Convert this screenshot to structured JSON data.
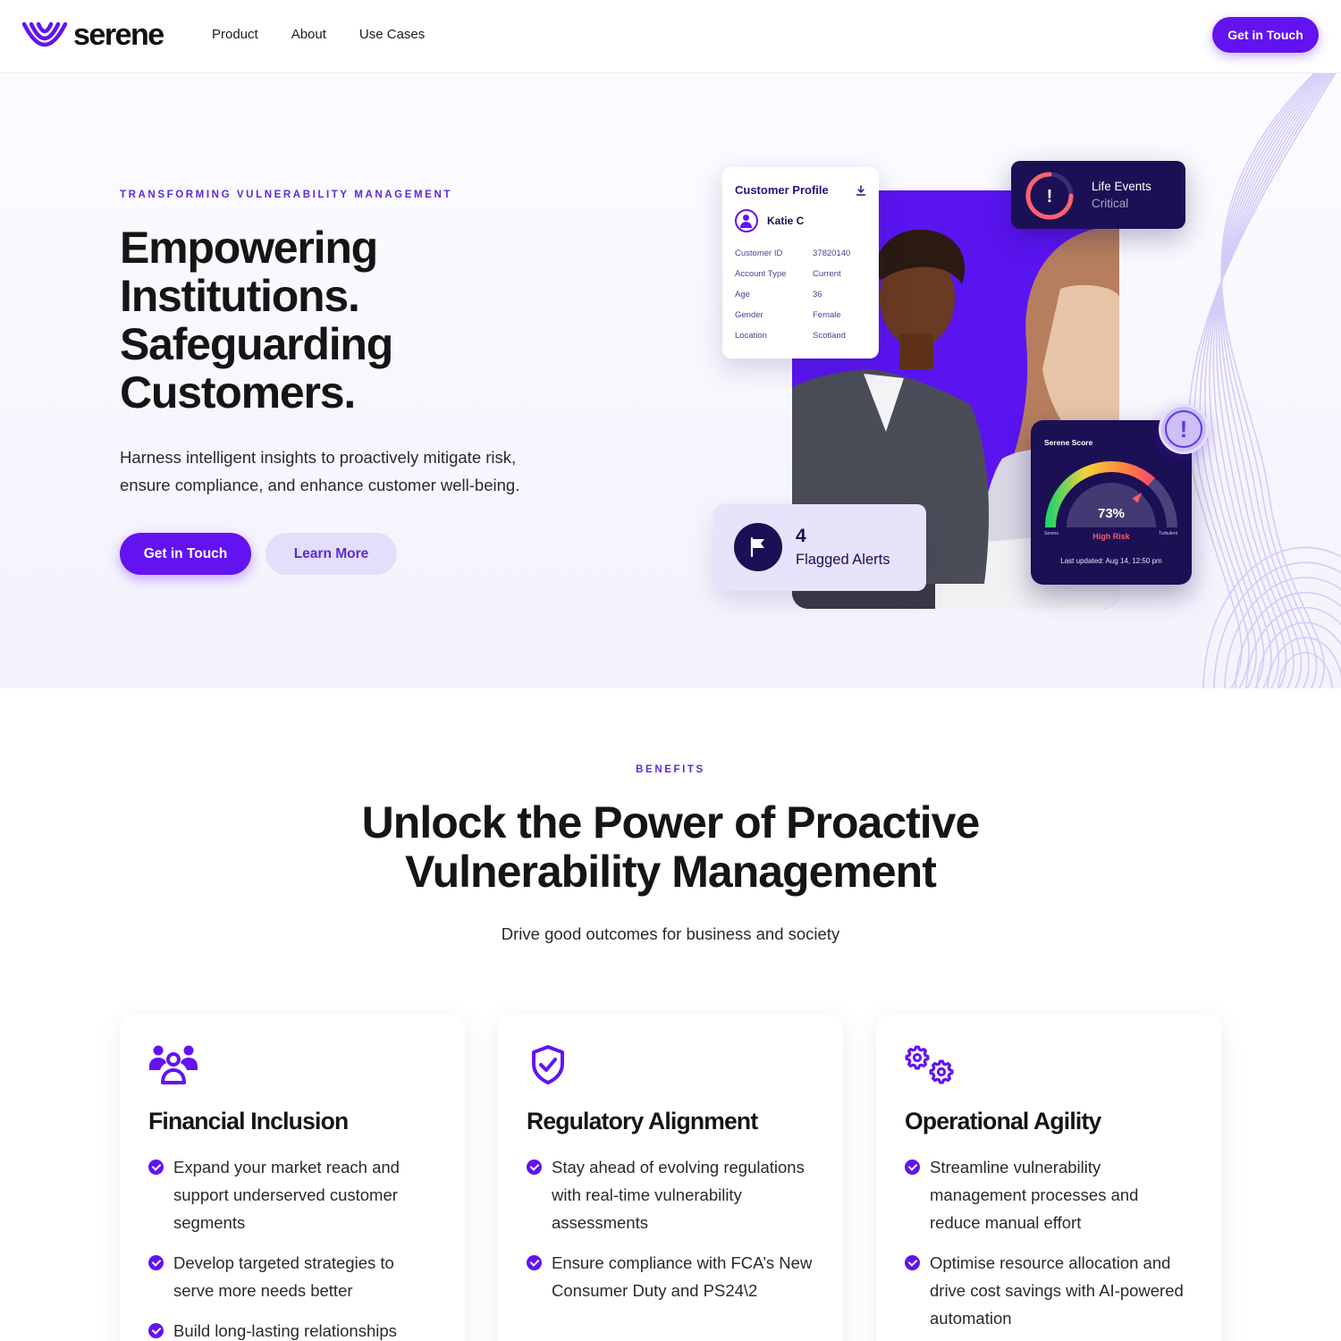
{
  "nav": {
    "brand": "serene",
    "links": [
      "Product",
      "About",
      "Use Cases"
    ],
    "cta": "Get in Touch"
  },
  "hero": {
    "eyebrow": "TRANSFORMING VULNERABILITY MANAGEMENT",
    "title_lines": [
      "Empowering",
      "Institutions.",
      "Safeguarding",
      "Customers."
    ],
    "subtitle_lines": [
      "Harness intelligent insights to proactively mitigate risk,",
      "ensure compliance, and enhance customer well-being."
    ],
    "primary_button": "Get in Touch",
    "secondary_button": "Learn More"
  },
  "profile_card": {
    "title": "Customer Profile",
    "name": "Katie C",
    "rows": [
      {
        "key": "Customer ID",
        "value": "37820140"
      },
      {
        "key": "Account Type",
        "value": "Current"
      },
      {
        "key": "Age",
        "value": "36"
      },
      {
        "key": "Gender",
        "value": "Female"
      },
      {
        "key": "Location",
        "value": "Scotland"
      }
    ]
  },
  "life_events": {
    "title": "Life Events",
    "status": "Critical",
    "icon_symbol": "!"
  },
  "flagged": {
    "count": "4",
    "label": "Flagged Alerts"
  },
  "score": {
    "title": "Serene Score",
    "percent_text": "73%",
    "percent": 73,
    "risk": "High Risk",
    "left_label": "Serene",
    "right_label": "Turbulent",
    "updated": "Last updated: Aug 14, 12:50 pm"
  },
  "alert_badge": "!",
  "benefits": {
    "eyebrow": "BENEFITS",
    "title_lines": [
      "Unlock the Power of Proactive",
      "Vulnerability Management"
    ],
    "subtitle": "Drive good outcomes for business and society",
    "cards": [
      {
        "icon": "users-icon",
        "title": "Financial Inclusion",
        "items": [
          "Expand your market reach and support underserved customer segments",
          "Develop targeted strategies to serve more needs better",
          "Build long-lasting relationships"
        ]
      },
      {
        "icon": "shield-check-icon",
        "title": "Regulatory Alignment",
        "items": [
          "Stay ahead of evolving regulations with real-time vulnerability assessments",
          "Ensure compliance with FCA’s New Consumer Duty and PS24\\2"
        ]
      },
      {
        "icon": "gears-icon",
        "title": "Operational Agility",
        "items": [
          "Streamline vulnerability management processes and reduce manual effort",
          "Optimise resource allocation and drive cost savings with AI-powered automation"
        ]
      }
    ]
  },
  "colors": {
    "accent": "#6213f0",
    "navy": "#1b1054",
    "soft_purple": "#e3defa",
    "risk_red": "#ff5b6e"
  }
}
